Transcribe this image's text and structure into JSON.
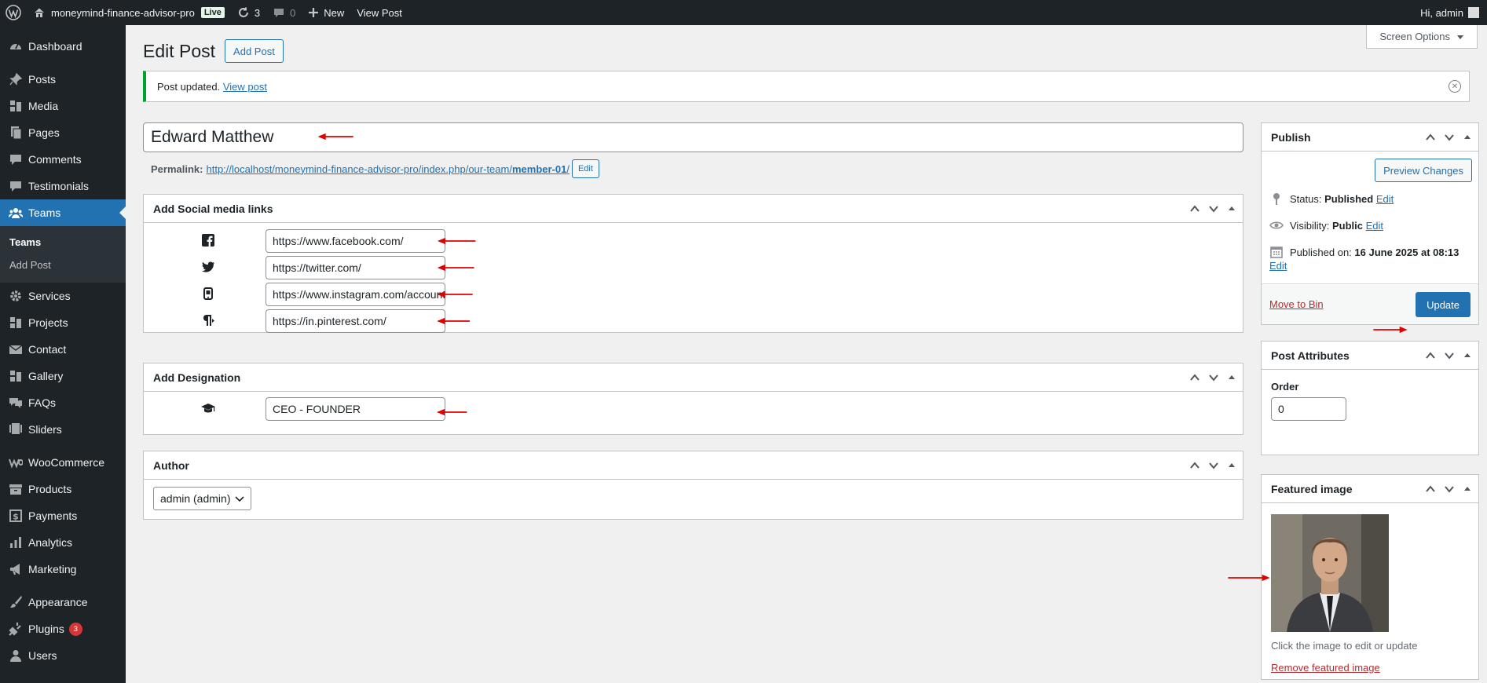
{
  "adminbar": {
    "site_name": "moneymind-finance-advisor-pro",
    "live_label": "Live",
    "updates_count": "3",
    "comments_count": "0",
    "new_label": "New",
    "view_post_label": "View Post",
    "greeting": "Hi, admin"
  },
  "sidebar": {
    "dashboard": "Dashboard",
    "posts": "Posts",
    "media": "Media",
    "pages": "Pages",
    "comments": "Comments",
    "testimonials": "Testimonials",
    "teams": "Teams",
    "sub_teams": "Teams",
    "sub_add_post": "Add Post",
    "services": "Services",
    "projects": "Projects",
    "contact": "Contact",
    "gallery": "Gallery",
    "faqs": "FAQs",
    "sliders": "Sliders",
    "woocommerce": "WooCommerce",
    "products": "Products",
    "payments": "Payments",
    "analytics": "Analytics",
    "marketing": "Marketing",
    "appearance": "Appearance",
    "plugins": "Plugins",
    "plugins_badge": "3",
    "users": "Users"
  },
  "header": {
    "screen_options": "Screen Options",
    "title": "Edit Post",
    "add_post_button": "Add Post"
  },
  "notice": {
    "text": "Post updated.",
    "link": "View post"
  },
  "post": {
    "title": "Edward Matthew",
    "permalink_label": "Permalink:",
    "permalink_base": "http://localhost/moneymind-finance-advisor-pro/index.php/our-team/",
    "permalink_slug": "member-01",
    "permalink_trailing": "/",
    "permalink_edit": "Edit"
  },
  "social_box": {
    "title": "Add Social media links",
    "facebook": "https://www.facebook.com/",
    "twitter": "https://twitter.com/",
    "instagram": "https://www.instagram.com/accounts/login/",
    "pinterest": "https://in.pinterest.com/"
  },
  "designation_box": {
    "title": "Add Designation",
    "value": "CEO - FOUNDER"
  },
  "author_box": {
    "title": "Author",
    "selected": "admin (admin)"
  },
  "publish_box": {
    "title": "Publish",
    "preview_button": "Preview Changes",
    "status_label": "Status:",
    "status_value": "Published",
    "visibility_label": "Visibility:",
    "visibility_value": "Public",
    "published_label": "Published on:",
    "published_value": "16 June 2025 at 08:13",
    "edit": "Edit",
    "move_to_bin": "Move to Bin",
    "update_button": "Update"
  },
  "attributes_box": {
    "title": "Post Attributes",
    "order_label": "Order",
    "order_value": "0"
  },
  "featured_box": {
    "title": "Featured image",
    "hint": "Click the image to edit or update",
    "remove_link": "Remove featured image"
  },
  "colors": {
    "accent": "#2271b1",
    "adminbar": "#1d2327",
    "annotation_arrow": "#e00000",
    "success": "#00a32a"
  }
}
